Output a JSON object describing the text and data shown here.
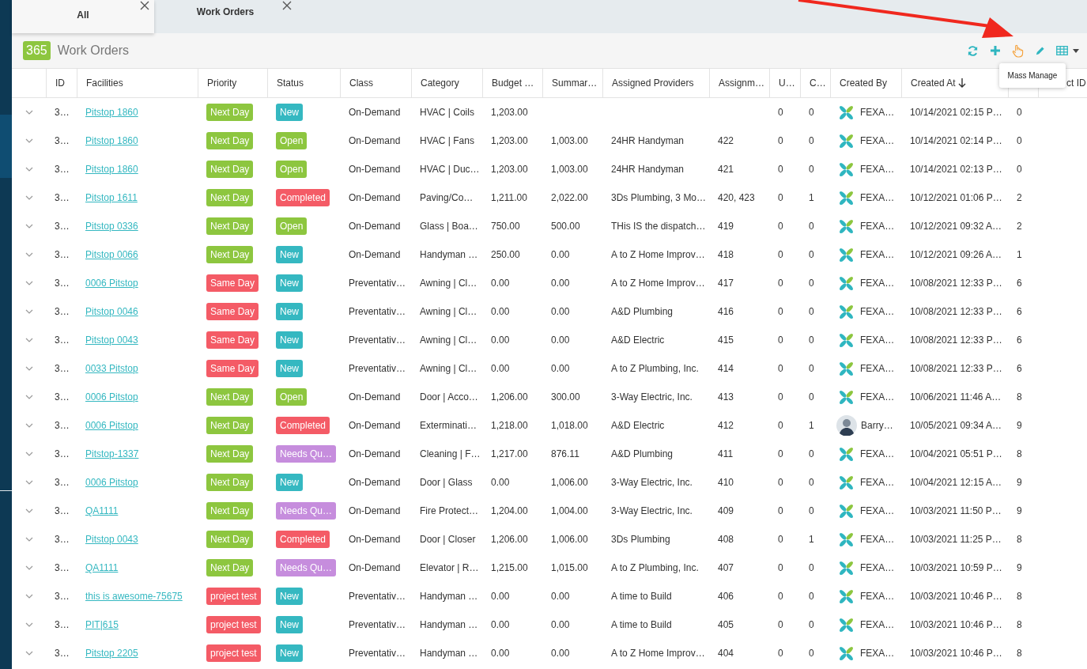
{
  "tabs": [
    {
      "label": "All",
      "selected": true
    },
    {
      "label": "Work Orders",
      "selected": false
    }
  ],
  "header": {
    "count": "365",
    "title": "Work Orders"
  },
  "tooltip": "Mass Manage",
  "columns": [
    {
      "label": "ID"
    },
    {
      "label": "Facilities"
    },
    {
      "label": "Priority"
    },
    {
      "label": "Status"
    },
    {
      "label": "Class"
    },
    {
      "label": "Category"
    },
    {
      "label": "Budget …"
    },
    {
      "label": "Summar…"
    },
    {
      "label": "Assigned Providers"
    },
    {
      "label": "Assignm…"
    },
    {
      "label": "U…"
    },
    {
      "label": "C…"
    },
    {
      "label": "Created By"
    },
    {
      "label": "Created At",
      "sorted": true
    },
    {},
    {
      "label": "ct ID"
    }
  ],
  "rows": [
    {
      "id": "3…",
      "facility": "Pitstop 1860",
      "priority": {
        "label": "Next Day",
        "color": "#8dc63f"
      },
      "status": {
        "label": "New",
        "color": "#35b8c1"
      },
      "class": "On-Demand",
      "category": "HVAC | Coils",
      "budget": "1,203.00",
      "u": "0",
      "c": "0",
      "created_by": {
        "name": "FEXA…",
        "kind": "logo"
      },
      "created_at": "10/14/2021 02:15 P…",
      "column_14": "0"
    },
    {
      "id": "3…",
      "facility": "Pitstop 1860",
      "priority": {
        "label": "Next Day",
        "color": "#8dc63f"
      },
      "status": {
        "label": "Open",
        "color": "#8dc63f"
      },
      "class": "On-Demand",
      "category": "HVAC | Fans",
      "budget": "1,203.00",
      "summary": "1,003.00",
      "providers": "24HR Handyman",
      "assignment": "422",
      "u": "0",
      "c": "0",
      "created_by": {
        "name": "FEXA…",
        "kind": "logo"
      },
      "created_at": "10/14/2021 02:14 P…",
      "column_14": "0"
    },
    {
      "id": "3…",
      "facility": "Pitstop 1860",
      "priority": {
        "label": "Next Day",
        "color": "#8dc63f"
      },
      "status": {
        "label": "Open",
        "color": "#8dc63f"
      },
      "class": "On-Demand",
      "category": "HVAC | Duc…",
      "budget": "1,203.00",
      "summary": "1,003.00",
      "providers": "24HR Handyman",
      "assignment": "421",
      "u": "0",
      "c": "0",
      "created_by": {
        "name": "FEXA…",
        "kind": "logo"
      },
      "created_at": "10/14/2021 02:13 P…",
      "column_14": "0"
    },
    {
      "id": "3…",
      "facility": "Pitstop 1611",
      "priority": {
        "label": "Next Day",
        "color": "#8dc63f"
      },
      "status": {
        "label": "Completed",
        "color": "#f45b66"
      },
      "class": "On-Demand",
      "category": "Paving/Co…",
      "budget": "1,211.00",
      "summary": "2,022.00",
      "providers": "3Ds Plumbing, 3 Mo…",
      "assignment": "420, 423",
      "u": "0",
      "c": "1",
      "created_by": {
        "name": "FEXA…",
        "kind": "logo"
      },
      "created_at": "10/12/2021 01:06 P…",
      "column_14": "2"
    },
    {
      "id": "3…",
      "facility": "Pitstop 0336",
      "priority": {
        "label": "Next Day",
        "color": "#8dc63f"
      },
      "status": {
        "label": "Open",
        "color": "#8dc63f"
      },
      "class": "On-Demand",
      "category": "Glass | Boa…",
      "budget": "750.00",
      "summary": "500.00",
      "providers": "THis IS the dispatch…",
      "assignment": "419",
      "u": "0",
      "c": "0",
      "created_by": {
        "name": "FEXA…",
        "kind": "logo"
      },
      "created_at": "10/12/2021 09:32 A…",
      "column_14": "2"
    },
    {
      "id": "3…",
      "facility": "Pitstop 0066",
      "priority": {
        "label": "Next Day",
        "color": "#8dc63f"
      },
      "status": {
        "label": "New",
        "color": "#35b8c1"
      },
      "class": "On-Demand",
      "category": "Handyman …",
      "budget": "250.00",
      "summary": "0.00",
      "providers": "A to Z Home Improv…",
      "assignment": "418",
      "u": "0",
      "c": "0",
      "created_by": {
        "name": "FEXA…",
        "kind": "logo"
      },
      "created_at": "10/12/2021 09:26 A…",
      "column_14": "1"
    },
    {
      "id": "3…",
      "facility": "0006 Pitstop",
      "priority": {
        "label": "Same Day",
        "color": "#f45b66"
      },
      "status": {
        "label": "New",
        "color": "#35b8c1"
      },
      "class": "Preventativ…",
      "category": "Awning | Cl…",
      "budget": "0.00",
      "summary": "0.00",
      "providers": "A to Z Home Improv…",
      "assignment": "417",
      "u": "0",
      "c": "0",
      "created_by": {
        "name": "FEXA…",
        "kind": "logo"
      },
      "created_at": "10/08/2021 12:33 P…",
      "column_14": "6"
    },
    {
      "id": "3…",
      "facility": "Pitstop 0046",
      "priority": {
        "label": "Same Day",
        "color": "#f45b66"
      },
      "status": {
        "label": "New",
        "color": "#35b8c1"
      },
      "class": "Preventativ…",
      "category": "Awning | Cl…",
      "budget": "0.00",
      "summary": "0.00",
      "providers": "A&D Plumbing",
      "assignment": "416",
      "u": "0",
      "c": "0",
      "created_by": {
        "name": "FEXA…",
        "kind": "logo"
      },
      "created_at": "10/08/2021 12:33 P…",
      "column_14": "6"
    },
    {
      "id": "3…",
      "facility": "Pitstop 0043",
      "priority": {
        "label": "Same Day",
        "color": "#f45b66"
      },
      "status": {
        "label": "New",
        "color": "#35b8c1"
      },
      "class": "Preventativ…",
      "category": "Awning | Cl…",
      "budget": "0.00",
      "summary": "0.00",
      "providers": "A&D Electric",
      "assignment": "415",
      "u": "0",
      "c": "0",
      "created_by": {
        "name": "FEXA…",
        "kind": "logo"
      },
      "created_at": "10/08/2021 12:33 P…",
      "column_14": "6"
    },
    {
      "id": "3…",
      "facility": "0033 Pitstop",
      "priority": {
        "label": "Same Day",
        "color": "#f45b66"
      },
      "status": {
        "label": "New",
        "color": "#35b8c1"
      },
      "class": "Preventativ…",
      "category": "Awning | Cl…",
      "budget": "0.00",
      "summary": "0.00",
      "providers": "A to Z Plumbing, Inc.",
      "assignment": "414",
      "u": "0",
      "c": "0",
      "created_by": {
        "name": "FEXA…",
        "kind": "logo"
      },
      "created_at": "10/08/2021 12:33 P…",
      "column_14": "6"
    },
    {
      "id": "3…",
      "facility": "0006 Pitstop",
      "priority": {
        "label": "Next Day",
        "color": "#8dc63f"
      },
      "status": {
        "label": "Open",
        "color": "#8dc63f"
      },
      "class": "On-Demand",
      "category": "Door | Acco…",
      "budget": "1,206.00",
      "summary": "300.00",
      "providers": "3-Way Electric, Inc.",
      "assignment": "413",
      "u": "0",
      "c": "0",
      "created_by": {
        "name": "FEXA…",
        "kind": "logo"
      },
      "created_at": "10/06/2021 11:46 A…",
      "column_14": "8"
    },
    {
      "id": "3…",
      "facility": "0006 Pitstop",
      "priority": {
        "label": "Next Day",
        "color": "#8dc63f"
      },
      "status": {
        "label": "Completed",
        "color": "#f45b66"
      },
      "class": "On-Demand",
      "category": "Exterminati…",
      "budget": "1,218.00",
      "summary": "1,018.00",
      "providers": "A&D Electric",
      "assignment": "412",
      "u": "0",
      "c": "1",
      "created_by": {
        "name": "Barry…",
        "kind": "photo"
      },
      "created_at": "10/05/2021 09:34 A…",
      "column_14": "9"
    },
    {
      "id": "3…",
      "facility": "Pitstop-1337",
      "priority": {
        "label": "Next Day",
        "color": "#8dc63f"
      },
      "status": {
        "label": "Needs Qu…",
        "color": "#c68ddd"
      },
      "class": "On-Demand",
      "category": "Cleaning | F…",
      "budget": "1,217.00",
      "summary": "876.11",
      "providers": "A&D Plumbing",
      "assignment": "411",
      "u": "0",
      "c": "0",
      "created_by": {
        "name": "FEXA…",
        "kind": "logo"
      },
      "created_at": "10/04/2021 05:51 P…",
      "column_14": "8"
    },
    {
      "id": "3…",
      "facility": "0006 Pitstop",
      "priority": {
        "label": "Next Day",
        "color": "#8dc63f"
      },
      "status": {
        "label": "New",
        "color": "#35b8c1"
      },
      "class": "On-Demand",
      "category": "Door | Glass",
      "budget": "0.00",
      "summary": "1,006.00",
      "providers": "3-Way Electric, Inc.",
      "assignment": "410",
      "u": "0",
      "c": "0",
      "created_by": {
        "name": "FEXA…",
        "kind": "logo"
      },
      "created_at": "10/04/2021 12:15 A…",
      "column_14": "9"
    },
    {
      "id": "3…",
      "facility": "QA1111",
      "priority": {
        "label": "Next Day",
        "color": "#8dc63f"
      },
      "status": {
        "label": "Needs Qu…",
        "color": "#c68ddd"
      },
      "class": "On-Demand",
      "category": "Fire Protect…",
      "budget": "1,204.00",
      "summary": "1,004.00",
      "providers": "3-Way Electric, Inc.",
      "assignment": "409",
      "u": "0",
      "c": "0",
      "created_by": {
        "name": "FEXA…",
        "kind": "logo"
      },
      "created_at": "10/03/2021 11:50 P…",
      "column_14": "9"
    },
    {
      "id": "3…",
      "facility": "Pitstop 0043",
      "priority": {
        "label": "Next Day",
        "color": "#8dc63f"
      },
      "status": {
        "label": "Completed",
        "color": "#f45b66"
      },
      "class": "On-Demand",
      "category": "Door | Closer",
      "budget": "1,206.00",
      "summary": "1,006.00",
      "providers": "3Ds Plumbing",
      "assignment": "408",
      "u": "0",
      "c": "1",
      "created_by": {
        "name": "FEXA…",
        "kind": "logo"
      },
      "created_at": "10/03/2021 11:25 P…",
      "column_14": "8"
    },
    {
      "id": "3…",
      "facility": "QA1111",
      "priority": {
        "label": "Next Day",
        "color": "#8dc63f"
      },
      "status": {
        "label": "Needs Qu…",
        "color": "#c68ddd"
      },
      "class": "On-Demand",
      "category": "Elevator | R…",
      "budget": "1,215.00",
      "summary": "1,015.00",
      "providers": "A to Z Plumbing, Inc.",
      "assignment": "407",
      "u": "0",
      "c": "0",
      "created_by": {
        "name": "FEXA…",
        "kind": "logo"
      },
      "created_at": "10/03/2021 10:59 P…",
      "column_14": "9"
    },
    {
      "id": "3…",
      "facility": "this is awesome-75675",
      "priority": {
        "label": "project test",
        "color": "#f45b66"
      },
      "status": {
        "label": "New",
        "color": "#35b8c1"
      },
      "class": "Preventativ…",
      "category": "Handyman …",
      "budget": "0.00",
      "summary": "0.00",
      "providers": "A time to Build",
      "assignment": "406",
      "u": "0",
      "c": "0",
      "created_by": {
        "name": "FEXA…",
        "kind": "logo"
      },
      "created_at": "10/03/2021 10:46 P…",
      "column_14": "8"
    },
    {
      "id": "3…",
      "facility": "PIT|615",
      "priority": {
        "label": "project test",
        "color": "#f45b66"
      },
      "status": {
        "label": "New",
        "color": "#35b8c1"
      },
      "class": "Preventativ…",
      "category": "Handyman …",
      "budget": "0.00",
      "summary": "0.00",
      "providers": "A time to Build",
      "assignment": "405",
      "u": "0",
      "c": "0",
      "created_by": {
        "name": "FEXA…",
        "kind": "logo"
      },
      "created_at": "10/03/2021 10:46 P…",
      "column_14": "8"
    },
    {
      "id": "3…",
      "facility": "Pitstop 2205",
      "priority": {
        "label": "project test",
        "color": "#f45b66"
      },
      "status": {
        "label": "New",
        "color": "#35b8c1"
      },
      "class": "Preventativ…",
      "category": "Handyman …",
      "budget": "0.00",
      "summary": "0.00",
      "providers": "A to Z Home Improv…",
      "assignment": "404",
      "u": "0",
      "c": "0",
      "created_by": {
        "name": "FEXA…",
        "kind": "logo"
      },
      "created_at": "10/03/2021 10:46 P…",
      "column_14": "8"
    }
  ]
}
